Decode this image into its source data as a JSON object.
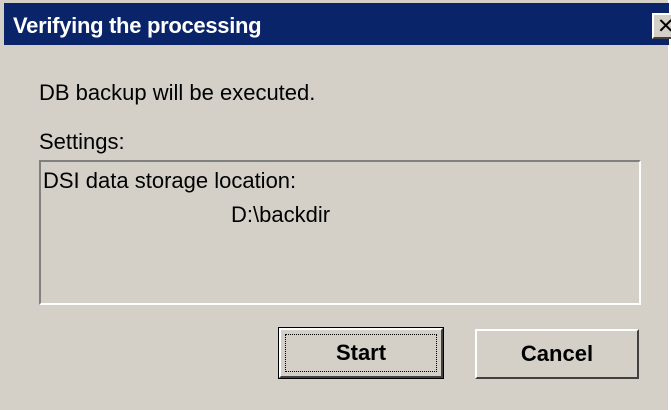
{
  "window": {
    "title": "Verifying the processing",
    "close_glyph": "✕"
  },
  "message": "DB backup will be executed.",
  "settings": {
    "label": "Settings:",
    "location_label": "DSI data storage location:",
    "location_value": "D:\\backdir"
  },
  "buttons": {
    "start_label": "Start",
    "cancel_label": "Cancel"
  },
  "colors": {
    "titlebar": "#0a246a",
    "face": "#d4d0c8"
  }
}
